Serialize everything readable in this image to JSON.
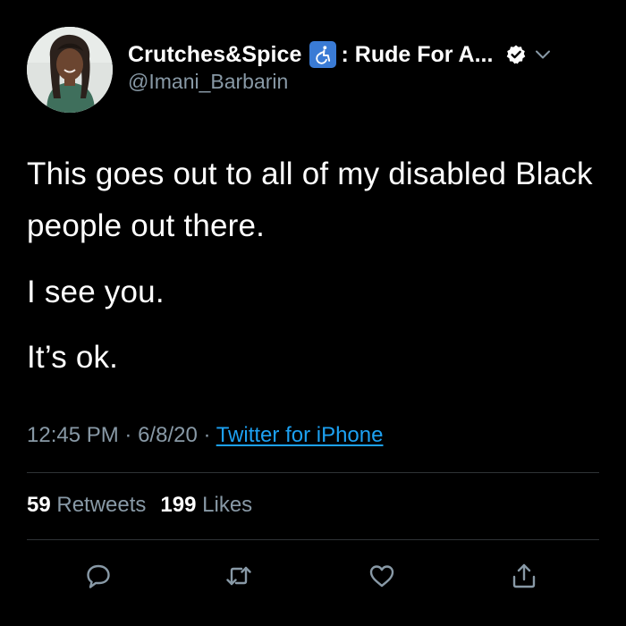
{
  "author": {
    "display_name": "Crutches&Spice",
    "badge_icon": "accessibility-icon",
    "name_suffix": ": Rude For A...",
    "handle": "@Imani_Barbarin",
    "verified": true
  },
  "tweet": {
    "paragraphs": [
      "This goes out to all of my disabled Black people out there.",
      "I see you.",
      "It’s ok."
    ],
    "time": "12:45 PM",
    "date": "6/8/20",
    "source": "Twitter for iPhone"
  },
  "stats": {
    "retweets_count": "59",
    "retweets_label": "Retweets",
    "likes_count": "199",
    "likes_label": "Likes"
  },
  "actions": [
    "reply-icon",
    "retweet-icon",
    "like-icon",
    "share-icon"
  ],
  "colors": {
    "background": "#000000",
    "text": "#ffffff",
    "secondary": "#8899a6",
    "link": "#1da1f2",
    "badge": "#3a7bd5"
  }
}
